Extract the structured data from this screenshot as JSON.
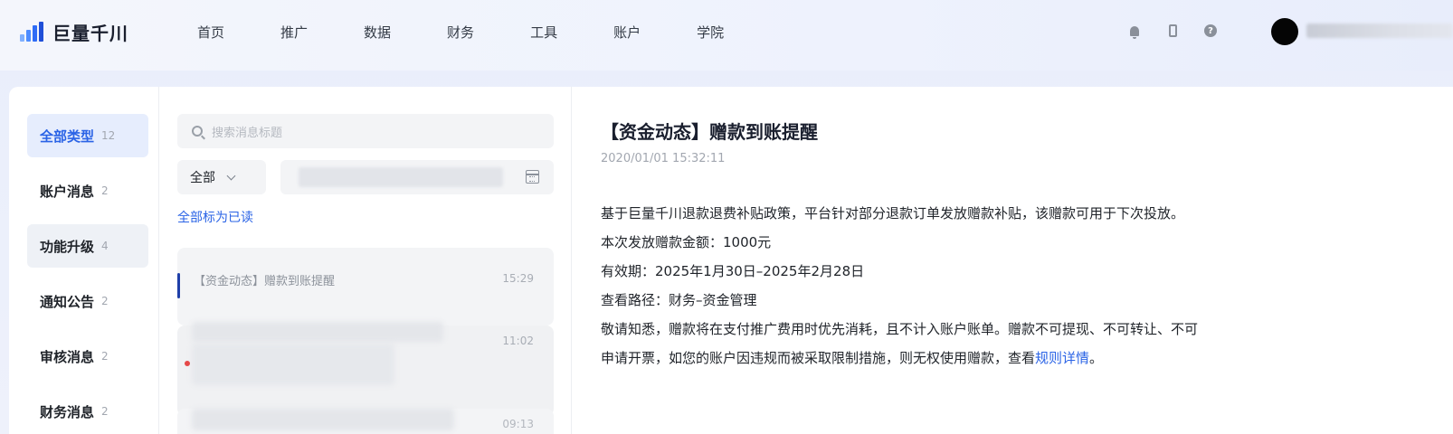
{
  "app": {
    "name": "巨量千川"
  },
  "nav": {
    "items": [
      "首页",
      "推广",
      "数据",
      "财务",
      "工具",
      "账户",
      "学院"
    ]
  },
  "header_icons": [
    "bell-icon",
    "phone-icon",
    "help-icon"
  ],
  "help_glyph": "?",
  "categories": [
    {
      "label": "全部类型",
      "count": "12",
      "active": true
    },
    {
      "label": "账户消息",
      "count": "2"
    },
    {
      "label": "功能升级",
      "count": "4"
    },
    {
      "label": "通知公告",
      "count": "2"
    },
    {
      "label": "审核消息",
      "count": "2"
    },
    {
      "label": "财务消息",
      "count": "2"
    }
  ],
  "message_list": {
    "search_placeholder": "搜索消息标题",
    "filter_value": "全部",
    "mark_all_read": "全部标为已读",
    "items": [
      {
        "title": "【资金动态】赠款到账提醒",
        "time": "15:29",
        "selected": true
      },
      {
        "title": "",
        "time": "11:02",
        "unread": true
      },
      {
        "title": "",
        "time": "09:13"
      }
    ]
  },
  "detail": {
    "title": "【资金动态】赠款到账提醒",
    "timestamp": "2020/01/01 15:32:11",
    "lines": [
      "基于巨量千川退款退费补贴政策，平台针对部分退款订单发放赠款补贴，该赠款可用于下次投放。",
      "本次发放赠款金额：1000元",
      "有效期：2025年1月30日–2025年2月28日",
      "查看路径：财务–资金管理",
      "敬请知悉，赠款将在支付推广费用时优先消耗，且不计入账户账单。赠款不可提现、不可转让、不可"
    ],
    "last_line_text": "申请开票，如您的账户因违规而被采取限制措施，则无权使用赠款，查看",
    "last_line_link": "规则详情",
    "last_line_end": "。"
  },
  "colors": {
    "accent": "#2a63e6",
    "unread_dot": "#e54848"
  }
}
